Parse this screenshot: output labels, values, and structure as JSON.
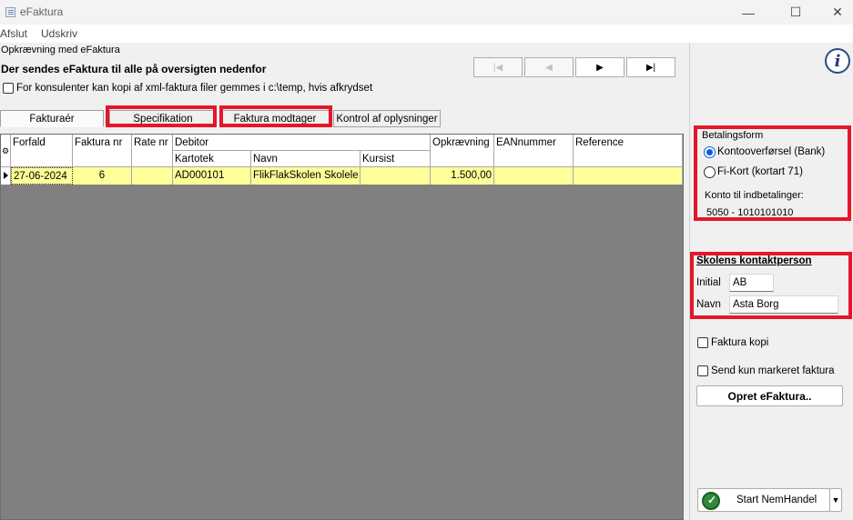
{
  "window": {
    "title": "eFaktura",
    "minimize_glyph": "—",
    "maximize_glyph": "☐",
    "close_glyph": "✕"
  },
  "menu": {
    "items": [
      "Afslut",
      "Udskriv"
    ]
  },
  "main": {
    "group_caption": "Opkrævning med eFaktura",
    "headline": "Der sendes eFaktura til alle på oversigten nedenfor",
    "copy_checkbox_label": "For konsulenter kan kopi af xml-faktura filer gemmes i c:\\temp, hvis afkrydset",
    "nav_buttons": [
      "|◀",
      "◀",
      "▶",
      "▶|"
    ]
  },
  "tabs": [
    "Fakturaér",
    "Specifikation",
    "Faktura modtager",
    "Kontrol af oplysninger"
  ],
  "grid": {
    "headers": {
      "forfald": "Forfald",
      "faktura_nr": "Faktura nr",
      "rate_nr": "Rate nr",
      "debitor": "Debitor",
      "kartotek": "Kartotek",
      "navn": "Navn",
      "kursist": "Kursist",
      "opkraevning": "Opkrævning",
      "eannummer": "EANnummer",
      "reference": "Reference"
    },
    "rows": [
      {
        "forfald": "27-06-2024",
        "faktura_nr": "6",
        "rate_nr": "",
        "kartotek": "AD000101",
        "navn": "FlikFlakSkolen Skolele…",
        "kursist": "",
        "opkraevning": "1.500,00",
        "eannummer": "",
        "reference": ""
      }
    ]
  },
  "sidebar": {
    "betalingsform": {
      "title": "Betalingsform",
      "options": [
        "Kontooverførsel (Bank)",
        "Fi-Kort (kortart 71)"
      ],
      "selected_index": 0,
      "konto_label": "Konto til indbetalinger:",
      "konto_value": "5050 - 1010101010"
    },
    "contact": {
      "title": "Skolens kontaktperson",
      "initial_label": "Initial",
      "initial_value": "AB",
      "navn_label": "Navn",
      "navn_value": "Asta Borg"
    },
    "faktura_kopi_label": "Faktura kopi",
    "send_markeret_label": "Send kun markeret faktura",
    "opret_button": "Opret eFaktura..",
    "start_button": "Start NemHandel"
  },
  "colors": {
    "highlight_red": "#e5162a",
    "selected_row": "#ffff99",
    "grid_background": "#808080",
    "radio_selected": "#0b5ed7"
  }
}
